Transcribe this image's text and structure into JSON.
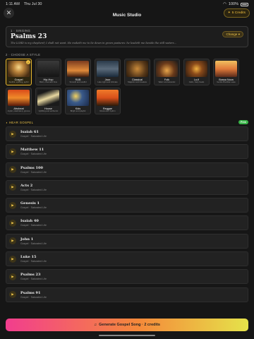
{
  "status": {
    "time": "1:11 AM",
    "date": "Thu Jul 30",
    "battery": "100%"
  },
  "header": {
    "title": "Music Studio",
    "credits_label": "5 Credits"
  },
  "scripture": {
    "label": "1 · SINGING",
    "title": "Psalms 23",
    "text": "The LORD is my shepherd; I shall not want. He maketh me to lie down in green pastures: he leadeth me beside the still waters...",
    "change_label": "Change"
  },
  "styles": {
    "label": "2 · CHOOSE A STYLE",
    "items": [
      {
        "name": "Gospel",
        "desc": "Soulful, uplifting, joyful",
        "selected": true
      },
      {
        "name": "Hip-Hop",
        "desc": "Bold, cinematic flow"
      },
      {
        "name": "R&B",
        "desc": "Smooth and soulful"
      },
      {
        "name": "Jazz",
        "desc": "Late night and intimate"
      },
      {
        "name": "Classical",
        "desc": "Majestic and timeless"
      },
      {
        "name": "Folk",
        "desc": "Warm and acoustic"
      },
      {
        "name": "Lo-fi",
        "desc": "Calm, hazy beats"
      },
      {
        "name": "Bossa Nova",
        "desc": "Gentle Brazilian ease"
      },
      {
        "name": "Afrobeat",
        "desc": "Joyful, celebratory groove"
      },
      {
        "name": "House",
        "desc": "Uplifting and anthemic"
      },
      {
        "name": "Kids",
        "desc": "Bright and playful"
      },
      {
        "name": "Reggae",
        "desc": "Roots and rhythm"
      }
    ]
  },
  "hear": {
    "label": "HEAR GOSPEL",
    "free_badge": "Free"
  },
  "songs": [
    {
      "title": "Isaiah 61",
      "sub": "Gospel · Saturated Life"
    },
    {
      "title": "Matthew 11",
      "sub": "Gospel · Saturated Life"
    },
    {
      "title": "Psalms 100",
      "sub": "Gospel · Saturated Life"
    },
    {
      "title": "Acts 2",
      "sub": "Gospel · Saturated Life"
    },
    {
      "title": "Genesis 1",
      "sub": "Gospel · Saturated Life"
    },
    {
      "title": "Isaiah 40",
      "sub": "Gospel · Saturated Life"
    },
    {
      "title": "John 1",
      "sub": "Gospel · Saturated Life"
    },
    {
      "title": "Luke 15",
      "sub": "Gospel · Saturated Life"
    },
    {
      "title": "Psalms 23",
      "sub": "Gospel · Saturated Life"
    },
    {
      "title": "Psalms 91",
      "sub": "Gospel · Saturated Life"
    }
  ],
  "generate": {
    "label": "Generate Gospel Song · 2 credits"
  },
  "colors": {
    "accent": "#f2c84b",
    "background": "#161616",
    "free": "#3bb54a"
  }
}
